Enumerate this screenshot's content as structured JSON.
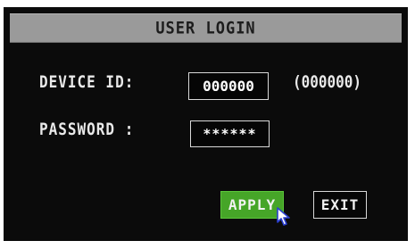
{
  "window": {
    "title": "USER LOGIN"
  },
  "form": {
    "device_id_label": "DEVICE ID:",
    "device_id_value": "000000",
    "device_id_hint": "(000000)",
    "password_label": "PASSWORD :",
    "password_value": "******"
  },
  "buttons": {
    "apply_label": "APPLY",
    "exit_label": "EXIT"
  },
  "colors": {
    "background": "#0b0b0b",
    "title_bar": "#9a9a9a",
    "apply_button": "#46a528",
    "text": "#e9e9e9"
  },
  "icons": {
    "pointer": "mouse-pointer-icon"
  }
}
